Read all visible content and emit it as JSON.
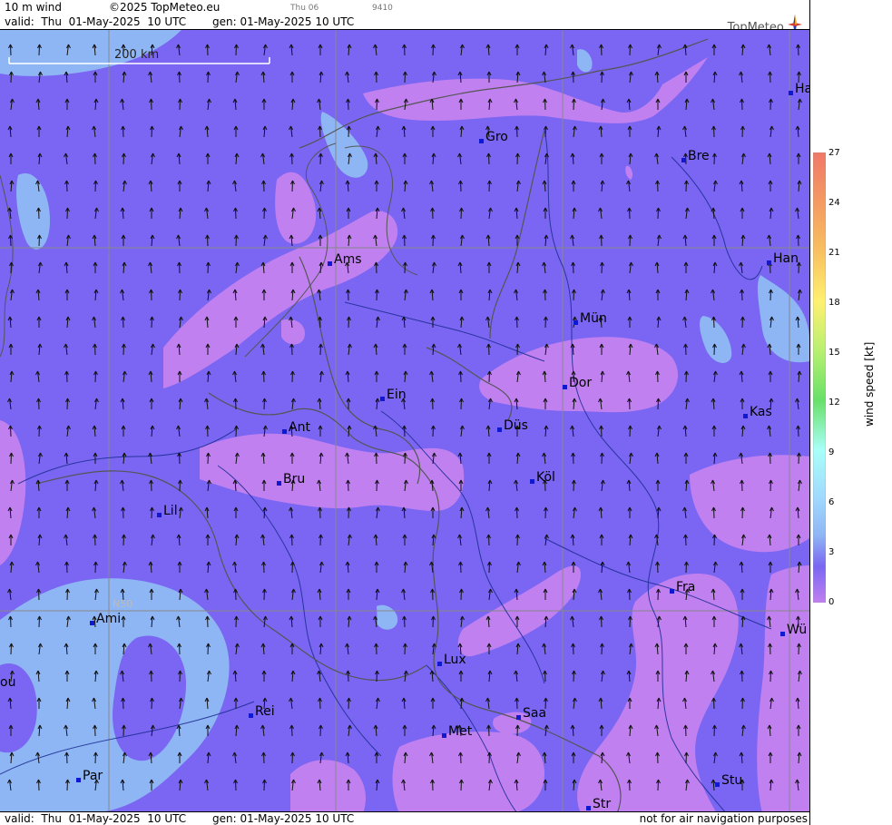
{
  "header": {
    "field": "10 m wind",
    "copyright": "©2025 TopMeteo.eu",
    "day": "Thu 06",
    "code": "9410",
    "valid": "valid:  Thu  01-May-2025  10 UTC",
    "gen": "gen: 01-May-2025 10 UTC",
    "brand": "TopMeteo"
  },
  "map": {
    "scale_label": "200 km",
    "lat_label": "N50",
    "cities": [
      {
        "name": "Gro"
      },
      {
        "name": "Bre"
      },
      {
        "name": "Ha"
      },
      {
        "name": "Ams"
      },
      {
        "name": "Han"
      },
      {
        "name": "Mün"
      },
      {
        "name": "Ein"
      },
      {
        "name": "Dor"
      },
      {
        "name": "Ant"
      },
      {
        "name": "Düs"
      },
      {
        "name": "Kas"
      },
      {
        "name": "Bru"
      },
      {
        "name": "Köl"
      },
      {
        "name": "Lil"
      },
      {
        "name": "Fra"
      },
      {
        "name": "Ami"
      },
      {
        "name": "Wü"
      },
      {
        "name": "ou"
      },
      {
        "name": "Lux"
      },
      {
        "name": "Rei"
      },
      {
        "name": "Saa"
      },
      {
        "name": "Met"
      },
      {
        "name": "Par"
      },
      {
        "name": "Stu"
      },
      {
        "name": "Str"
      }
    ]
  },
  "footer": {
    "valid": "valid:  Thu  01-May-2025  10 UTC",
    "gen": "gen: 01-May-2025 10 UTC",
    "note": "not for air navigation purposes"
  },
  "legend": {
    "unit": "wind speed  [kt]",
    "ticks": [
      "27",
      "24",
      "21",
      "18",
      "15",
      "12",
      "9",
      "6",
      "3",
      "0"
    ],
    "colors": [
      "#f08070",
      "#f4a060",
      "#f8c860",
      "#fff070",
      "#c8f070",
      "#70e070",
      "#a0fff8",
      "#a8e0ff",
      "#90c0f8",
      "#7a66f2",
      "#c080f0"
    ]
  }
}
